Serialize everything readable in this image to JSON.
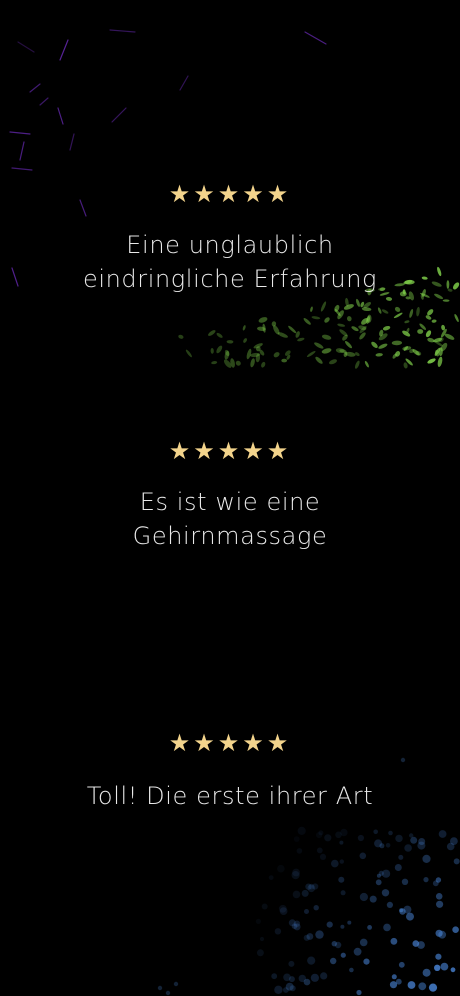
{
  "reviews": [
    {
      "rating": 5,
      "stars": "★★★★★",
      "quote": "Eine unglaublich\neindringliche Erfahrung"
    },
    {
      "rating": 5,
      "stars": "★★★★★",
      "quote": "Es ist wie eine\nGehirnmassage"
    },
    {
      "rating": 5,
      "stars": "★★★★★",
      "quote": "Toll! Die erste ihrer Art"
    }
  ],
  "colors": {
    "background": "#000000",
    "star": "#f3d48c",
    "text": "#e9e9e9",
    "decor_purple": "#6a2bb8",
    "decor_green": "#7fcf4a",
    "decor_blue": "#4a86d9"
  }
}
